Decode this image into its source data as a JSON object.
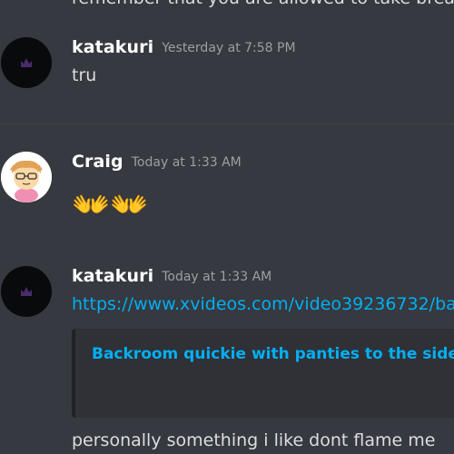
{
  "top_clipped_text": "remember that you are allowed to take breaks",
  "messages": [
    {
      "username": "katakuri",
      "timestamp": "Yesterday at 7:58 PM",
      "text": "tru"
    },
    {
      "username": "Craig",
      "timestamp": "Today at 1:33 AM",
      "emoji": "👐👐"
    },
    {
      "username": "katakuri",
      "timestamp": "Today at 1:33 AM",
      "link": "https://www.xvideos.com/video39236732/ba",
      "embed_title": "Backroom quickie with panties to the side",
      "text": "personally something i like dont flame me"
    }
  ],
  "colors": {
    "background": "#36393f",
    "link": "#00aff4",
    "embed_bg": "#2f3136",
    "username": "#ffffff",
    "timestamp": "#9c9fa4"
  }
}
